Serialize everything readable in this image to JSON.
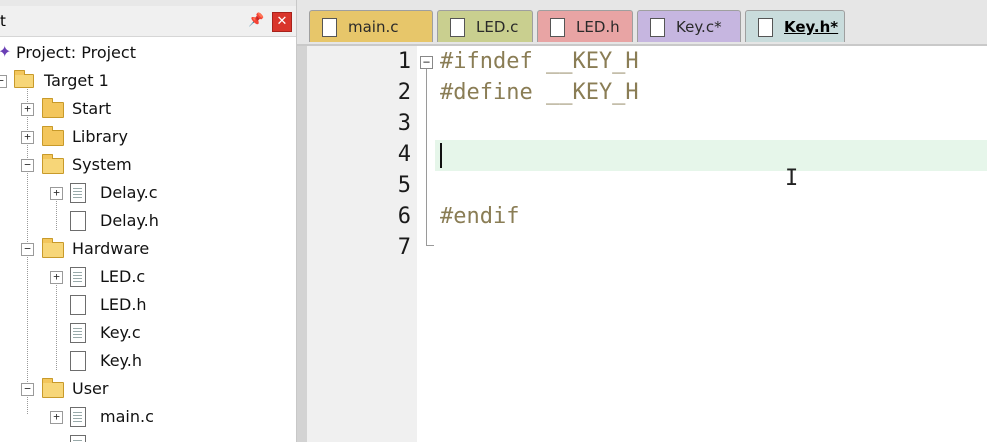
{
  "project_panel": {
    "title": "t",
    "project_label": "Project: Project",
    "tree": [
      {
        "label": "Target 1",
        "kind": "target",
        "level": 0,
        "expander": "−"
      },
      {
        "label": "Start",
        "kind": "folder",
        "level": 1,
        "expander": "+"
      },
      {
        "label": "Library",
        "kind": "folder",
        "level": 1,
        "expander": "+"
      },
      {
        "label": "System",
        "kind": "folder",
        "level": 1,
        "expander": "−"
      },
      {
        "label": "Delay.c",
        "kind": "file-c",
        "level": 2,
        "expander": "+"
      },
      {
        "label": "Delay.h",
        "kind": "file-h",
        "level": 2,
        "expander": ""
      },
      {
        "label": "Hardware",
        "kind": "folder",
        "level": 1,
        "expander": "−"
      },
      {
        "label": "LED.c",
        "kind": "file-c",
        "level": 2,
        "expander": "+"
      },
      {
        "label": "LED.h",
        "kind": "file-h",
        "level": 2,
        "expander": ""
      },
      {
        "label": "Key.c",
        "kind": "file-c",
        "level": 2,
        "expander": ""
      },
      {
        "label": "Key.h",
        "kind": "file-h",
        "level": 2,
        "expander": ""
      },
      {
        "label": "User",
        "kind": "folder",
        "level": 1,
        "expander": "−"
      },
      {
        "label": "main.c",
        "kind": "file-c",
        "level": 2,
        "expander": "+"
      }
    ]
  },
  "tabs": [
    {
      "label": "main.c",
      "color": "#e7c66a",
      "active": false
    },
    {
      "label": "LED.c",
      "color": "#c9cf8f",
      "active": false
    },
    {
      "label": "LED.h",
      "color": "#e8a4a4",
      "active": false
    },
    {
      "label": "Key.c*",
      "color": "#c6b6e0",
      "active": false
    },
    {
      "label": "Key.h*",
      "color": "#c9dcdc",
      "active": true
    }
  ],
  "editor": {
    "lines": [
      {
        "num": "1",
        "text": "#ifndef __KEY_H"
      },
      {
        "num": "2",
        "text": "#define __KEY_H"
      },
      {
        "num": "3",
        "text": ""
      },
      {
        "num": "4",
        "text": ""
      },
      {
        "num": "5",
        "text": ""
      },
      {
        "num": "6",
        "text": "#endif"
      },
      {
        "num": "7",
        "text": ""
      }
    ],
    "current_line": 4,
    "current_line_color": "#e6f6ea"
  },
  "icons": {
    "pin": "pin-icon",
    "close": "close-icon",
    "fold": "fold-minus-icon",
    "cursor": "text-cursor-icon"
  }
}
